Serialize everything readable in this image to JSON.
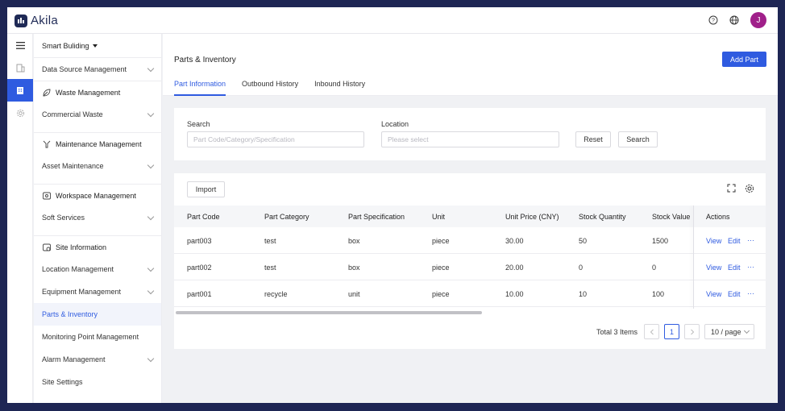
{
  "app": {
    "name": "Akila",
    "avatar_initial": "J"
  },
  "topbar": {
    "icons": [
      "help-icon",
      "globe-icon"
    ]
  },
  "rail": {
    "icons": [
      "menu-icon",
      "building-icon",
      "building-active-icon",
      "gear-icon"
    ]
  },
  "sidebar": {
    "site_selector": "Smart Buliding",
    "items": [
      {
        "label": "Data Source Management",
        "chevron": true
      },
      {
        "section": "Waste Management"
      },
      {
        "label": "Commercial Waste",
        "chevron": true
      },
      {
        "section": "Maintenance Management"
      },
      {
        "label": "Asset Maintenance",
        "chevron": true
      },
      {
        "section": "Workspace Management"
      },
      {
        "label": "Soft Services",
        "chevron": true
      },
      {
        "section": "Site Information"
      },
      {
        "label": "Location Management",
        "chevron": true
      },
      {
        "label": "Equipment Management",
        "chevron": true
      },
      {
        "label": "Parts & Inventory",
        "active": true
      },
      {
        "label": "Monitoring Point Management"
      },
      {
        "label": "Alarm Management",
        "chevron": true
      },
      {
        "label": "Site Settings"
      }
    ]
  },
  "page": {
    "title": "Parts & Inventory",
    "add_button": "Add Part",
    "tabs": [
      "Part Information",
      "Outbound History",
      "Inbound History"
    ]
  },
  "search": {
    "search_label": "Search",
    "search_placeholder": "Part Code/Category/Specification",
    "location_label": "Location",
    "location_placeholder": "Please select",
    "reset": "Reset",
    "search_button": "Search"
  },
  "table": {
    "import_button": "Import",
    "columns": [
      "Part Code",
      "Part Category",
      "Part Specification",
      "Unit",
      "Unit Price (CNY)",
      "Stock Quantity",
      "Stock Value",
      "Actions"
    ],
    "rows": [
      [
        "part003",
        "test",
        "box",
        "piece",
        "30.00",
        "50",
        "1500"
      ],
      [
        "part002",
        "test",
        "box",
        "piece",
        "20.00",
        "0",
        "0"
      ],
      [
        "part001",
        "recycle",
        "unit",
        "piece",
        "10.00",
        "10",
        "100"
      ]
    ],
    "actions": {
      "view": "View",
      "edit": "Edit",
      "more": "···"
    }
  },
  "pagination": {
    "total": "Total 3 Items",
    "current_page": "1",
    "page_size": "10 / page"
  },
  "colors": {
    "primary": "#2f5be0",
    "brand": "#1f2a56",
    "avatar": "#a0208a"
  }
}
